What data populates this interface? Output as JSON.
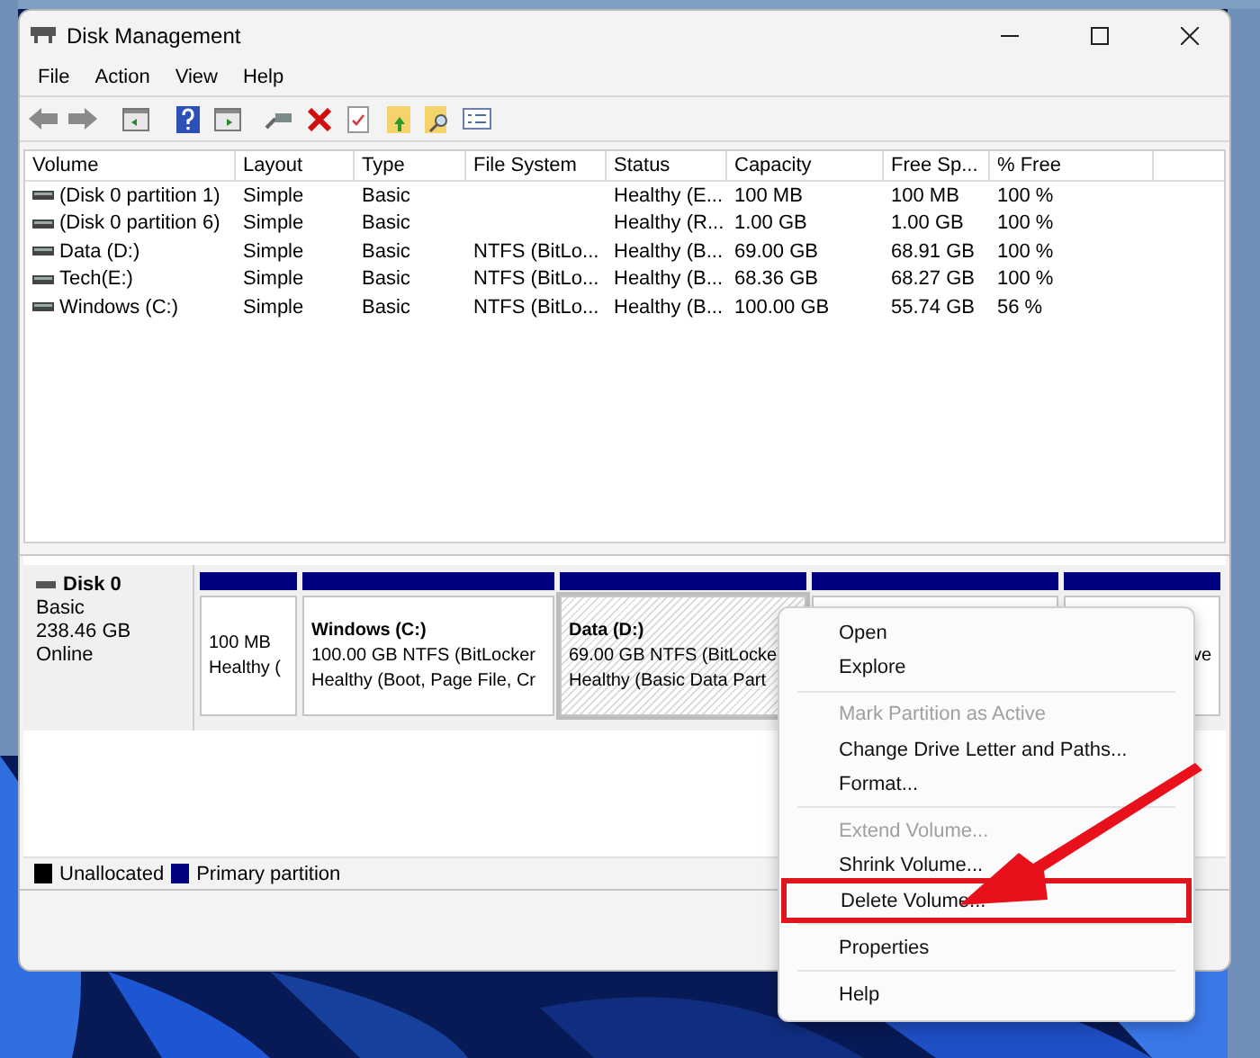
{
  "window": {
    "title": "Disk Management"
  },
  "menu": [
    "File",
    "Action",
    "View",
    "Help"
  ],
  "toolbar": [
    {
      "kind": "back",
      "disabled": false
    },
    {
      "kind": "forward",
      "disabled": false
    },
    {
      "kind": "sep"
    },
    {
      "kind": "panel"
    },
    {
      "kind": "sep"
    },
    {
      "kind": "help"
    },
    {
      "kind": "panel2"
    },
    {
      "kind": "sep"
    },
    {
      "kind": "connect"
    },
    {
      "kind": "delete"
    },
    {
      "kind": "check"
    },
    {
      "kind": "folder-up"
    },
    {
      "kind": "folder-search"
    },
    {
      "kind": "list"
    }
  ],
  "table": {
    "columns": [
      "Volume",
      "Layout",
      "Type",
      "File System",
      "Status",
      "Capacity",
      "Free Sp...",
      "% Free"
    ],
    "rows": [
      [
        "(Disk 0 partition 1)",
        "Simple",
        "Basic",
        "",
        "Healthy (E...",
        "100 MB",
        "100 MB",
        "100 %"
      ],
      [
        "(Disk 0 partition 6)",
        "Simple",
        "Basic",
        "",
        "Healthy (R...",
        "1.00 GB",
        "1.00 GB",
        "100 %"
      ],
      [
        "Data (D:)",
        "Simple",
        "Basic",
        "NTFS (BitLo...",
        "Healthy (B...",
        "69.00 GB",
        "68.91 GB",
        "100 %"
      ],
      [
        "Tech(E:)",
        "Simple",
        "Basic",
        "NTFS (BitLo...",
        "Healthy (B...",
        "68.36 GB",
        "68.27 GB",
        "100 %"
      ],
      [
        "Windows (C:)",
        "Simple",
        "Basic",
        "NTFS (BitLo...",
        "Healthy (B...",
        "100.00 GB",
        "55.74 GB",
        "56 %"
      ]
    ]
  },
  "disk": {
    "name": "Disk 0",
    "lines": [
      "Basic",
      "238.46 GB",
      "Online"
    ],
    "partitions": [
      {
        "lines": [
          "100 MB",
          "Healthy ("
        ],
        "selected": false
      },
      {
        "name": "Windows  (C:)",
        "lines": [
          "100.00 GB NTFS (BitLocker",
          "Healthy (Boot, Page File, Cr"
        ],
        "selected": false
      },
      {
        "name": "Data  (D:)",
        "lines": [
          "69.00 GB NTFS (BitLocke",
          "Healthy (Basic Data Part"
        ],
        "selected": true
      },
      {
        "selected": false
      },
      {
        "lines": [
          "ve"
        ],
        "selected": false
      }
    ]
  },
  "legend": [
    {
      "label": "Unallocated",
      "color": "#000000"
    },
    {
      "label": "Primary partition",
      "color": "#000080"
    }
  ],
  "context_menu": [
    {
      "kind": "item",
      "label": "Open",
      "disabled": false,
      "highlighted": false
    },
    {
      "kind": "item",
      "label": "Explore",
      "disabled": false,
      "highlighted": false
    },
    {
      "kind": "sep"
    },
    {
      "kind": "item",
      "label": "Mark Partition as Active",
      "disabled": true,
      "highlighted": false
    },
    {
      "kind": "item",
      "label": "Change Drive Letter and Paths...",
      "disabled": false,
      "highlighted": false
    },
    {
      "kind": "item",
      "label": "Format...",
      "disabled": false,
      "highlighted": false
    },
    {
      "kind": "sep"
    },
    {
      "kind": "item",
      "label": "Extend Volume...",
      "disabled": true,
      "highlighted": false
    },
    {
      "kind": "item",
      "label": "Shrink Volume...",
      "disabled": false,
      "highlighted": false
    },
    {
      "kind": "item",
      "label": "Delete Volume...",
      "disabled": false,
      "highlighted": true
    },
    {
      "kind": "sep"
    },
    {
      "kind": "item",
      "label": "Properties",
      "disabled": false,
      "highlighted": false
    },
    {
      "kind": "sep"
    },
    {
      "kind": "item",
      "label": "Help",
      "disabled": false,
      "highlighted": false
    }
  ]
}
